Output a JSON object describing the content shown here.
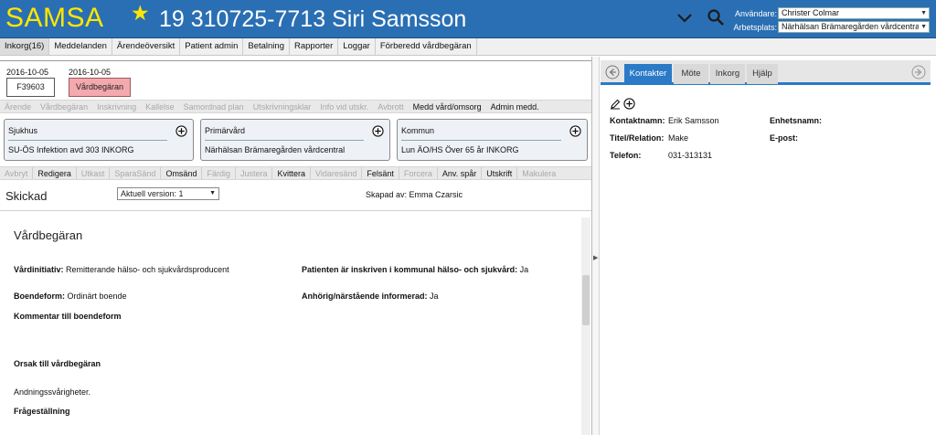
{
  "header": {
    "brand": "SAMSA",
    "patient": "19 310725-7713 Siri Samsson",
    "user_label": "Användare:",
    "user_value": "Christer Colmar",
    "workplace_label": "Arbetsplats:",
    "workplace_value": "Närhälsan Brämaregården vårdcentra",
    "colors": {
      "bar": "#2a6fb3",
      "brand": "#ffe600"
    },
    "icons": [
      "star-icon",
      "chevron-down-icon",
      "search-icon"
    ]
  },
  "menu": [
    {
      "label": "Inkorg(16)"
    },
    {
      "label": "Meddelanden"
    },
    {
      "label": "Ärendeöversikt"
    },
    {
      "label": "Patient admin"
    },
    {
      "label": "Betalning"
    },
    {
      "label": "Rapporter"
    },
    {
      "label": "Loggar"
    },
    {
      "label": "Förberedd vårdbegäran"
    }
  ],
  "documents": [
    {
      "date": "2016-10-05",
      "label": "F39603"
    },
    {
      "date": "2016-10-05",
      "label": "Vårdbegäran"
    }
  ],
  "toolbar1": [
    {
      "label": "Ärende",
      "enabled": false
    },
    {
      "label": "Vårdbegäran",
      "enabled": false
    },
    {
      "label": "Inskrivning",
      "enabled": false
    },
    {
      "label": "Kallelse",
      "enabled": false
    },
    {
      "label": "Samordnad plan",
      "enabled": false
    },
    {
      "label": "Utskrivningsklar",
      "enabled": false
    },
    {
      "label": "Info vid utskr.",
      "enabled": false
    },
    {
      "label": "Avbrott",
      "enabled": false
    },
    {
      "label": "Medd vård/omsorg",
      "enabled": true
    },
    {
      "label": "Admin medd.",
      "enabled": true
    }
  ],
  "cards": [
    {
      "title": "Sjukhus",
      "value": "SU-ÖS Infektion avd 303 INKORG"
    },
    {
      "title": "Primärvård",
      "value": "Närhälsan Brämaregården vårdcentral"
    },
    {
      "title": "Kommun",
      "value": "Lun ÄO/HS Över 65 år INKORG"
    }
  ],
  "toolbar2": [
    {
      "label": "Avbryt",
      "enabled": false
    },
    {
      "label": "Redigera",
      "enabled": true
    },
    {
      "label": "Utkast",
      "enabled": false
    },
    {
      "label": "SparaSänd",
      "enabled": false
    },
    {
      "label": "Omsänd",
      "enabled": true
    },
    {
      "label": "Färdig",
      "enabled": false
    },
    {
      "label": "Justera",
      "enabled": false
    },
    {
      "label": "Kvittera",
      "enabled": true
    },
    {
      "label": "Vidaresänd",
      "enabled": false
    },
    {
      "label": "Felsänt",
      "enabled": true
    },
    {
      "label": "Forcera",
      "enabled": false
    },
    {
      "label": "Anv. spår",
      "enabled": true
    },
    {
      "label": "Utskrift",
      "enabled": true
    },
    {
      "label": "Makulera",
      "enabled": false
    }
  ],
  "version_bar": {
    "status": "Skickad",
    "version": "Aktuell version: 1",
    "created_by": "Skapad av: Emma Czarsic"
  },
  "form": {
    "heading": "Vårdbegäran",
    "vardinitiativ_label": "Vårdinitiativ:",
    "vardinitiativ_value": "Remitterande hälso- och sjukvårdsproducent",
    "inskriven_label": "Patienten är inskriven i kommunal hälso- och sjukvård:",
    "inskriven_value": "Ja",
    "boendeform_label": "Boendeform:",
    "boendeform_value": "Ordinärt boende",
    "informerad_label": "Anhörig/närstående informerad:",
    "informerad_value": "Ja",
    "kommentar_label": "Kommentar till boendeform",
    "orsak_label": "Orsak till vårdbegäran",
    "orsak_value": "Andningssvårigheter.",
    "fragestallning_label": "Frågeställning"
  },
  "right_panel": {
    "tabs": [
      {
        "label": "Kontakter",
        "active": true
      },
      {
        "label": "Möte",
        "active": false
      },
      {
        "label": "Inkorg",
        "active": false
      },
      {
        "label": "Hjälp",
        "active": false
      }
    ],
    "kontaktnamn_label": "Kontaktnamn:",
    "kontaktnamn_value": "Erik Samsson",
    "enhetsnamn_label": "Enhetsnamn:",
    "titel_label": "Titel/Relation:",
    "titel_value": "Make",
    "epost_label": "E-post:",
    "telefon_label": "Telefon:",
    "telefon_value": "031-313131",
    "accent": "#2a7ac7"
  }
}
